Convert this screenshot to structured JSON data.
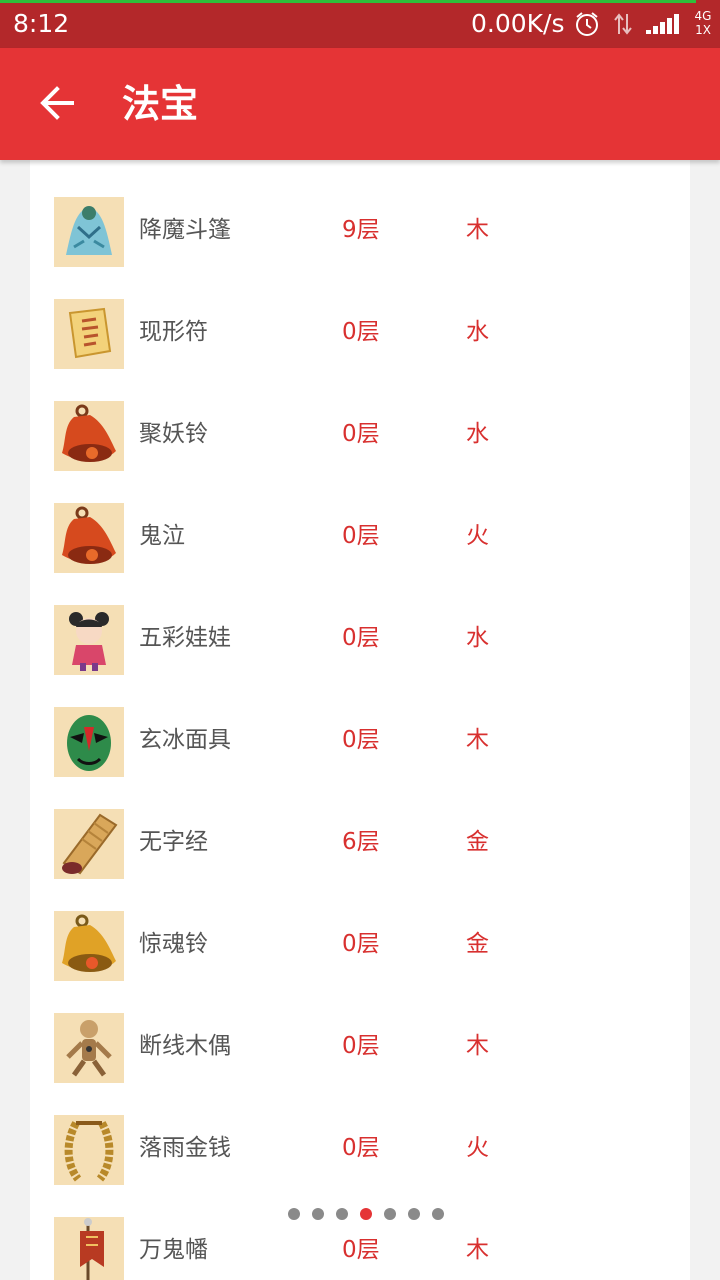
{
  "status_bar": {
    "time": "8:12",
    "net_speed": "0.00K/s",
    "network_type": "4G",
    "sim_slot": "1X",
    "icons": [
      "alarm-icon",
      "data-transfer-icon",
      "signal-icon"
    ]
  },
  "toolbar": {
    "title": "法宝",
    "back_icon": "arrow-left-icon",
    "color": "#e53436"
  },
  "items": [
    {
      "name": "",
      "level": "",
      "element": "",
      "icon": "partial-treasure"
    },
    {
      "name": "降魔斗篷",
      "level": "9层",
      "element": "木",
      "icon": "cloak"
    },
    {
      "name": "现形符",
      "level": "0层",
      "element": "水",
      "icon": "scroll-talisman"
    },
    {
      "name": "聚妖铃",
      "level": "0层",
      "element": "水",
      "icon": "red-bell"
    },
    {
      "name": "鬼泣",
      "level": "0层",
      "element": "火",
      "icon": "red-bell"
    },
    {
      "name": "五彩娃娃",
      "level": "0层",
      "element": "水",
      "icon": "doll"
    },
    {
      "name": "玄冰面具",
      "level": "0层",
      "element": "木",
      "icon": "opera-mask"
    },
    {
      "name": "无字经",
      "level": "6层",
      "element": "金",
      "icon": "rolled-scroll"
    },
    {
      "name": "惊魂铃",
      "level": "0层",
      "element": "金",
      "icon": "gold-bell"
    },
    {
      "name": "断线木偶",
      "level": "0层",
      "element": "木",
      "icon": "puppet"
    },
    {
      "name": "落雨金钱",
      "level": "0层",
      "element": "火",
      "icon": "coin-string"
    },
    {
      "name": "万鬼幡",
      "level": "0层",
      "element": "木",
      "icon": "banner"
    }
  ],
  "pager": {
    "count": 7,
    "active_index": 3
  },
  "colors": {
    "accent": "#e53436",
    "status_bar": "#b3282a",
    "text_red": "#d8302f",
    "thumb_bg": "#f5dfb5"
  }
}
